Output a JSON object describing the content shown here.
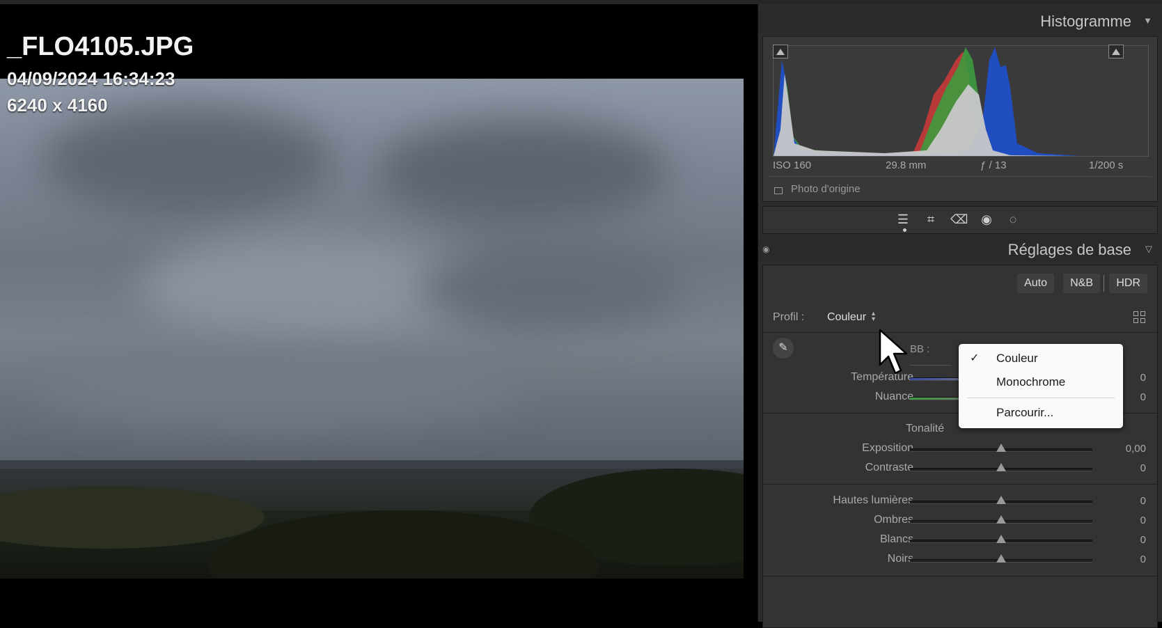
{
  "viewer": {
    "filename": "_FLO4105.JPG",
    "datetime": "04/09/2024 16:34:23",
    "dimensions": "6240 x 4160"
  },
  "histogram": {
    "title": "Histogramme",
    "exif": {
      "iso": "ISO 160",
      "focal": "29.8 mm",
      "aperture": "ƒ / 13",
      "shutter": "1/200 s"
    },
    "original_photo_label": "Photo d'origine"
  },
  "tools": [
    "edit-sliders-icon",
    "crop-icon",
    "eraser-icon",
    "red-eye-icon",
    "mask-icon"
  ],
  "basic": {
    "title": "Réglages de base",
    "buttons": {
      "auto": "Auto",
      "bw": "N&B",
      "hdr": "HDR"
    },
    "profile_label": "Profil :",
    "profile_value": "Couleur",
    "wb_label": "BB :",
    "sliders_wb": [
      {
        "label": "Température",
        "value": "0"
      },
      {
        "label": "Nuance",
        "value": "0"
      }
    ],
    "tone_title": "Tonalité",
    "sliders_tone": [
      {
        "label": "Exposition",
        "value": "0,00"
      },
      {
        "label": "Contraste",
        "value": "0"
      }
    ],
    "sliders_presence": [
      {
        "label": "Hautes lumières",
        "value": "0"
      },
      {
        "label": "Ombres",
        "value": "0"
      },
      {
        "label": "Blancs",
        "value": "0"
      },
      {
        "label": "Noirs",
        "value": "0"
      }
    ]
  },
  "profile_menu": {
    "items": [
      "Couleur",
      "Monochrome"
    ],
    "selected": "Couleur",
    "browse": "Parcourir..."
  },
  "colors": {
    "panel": "#2c2c2c",
    "red": "#c83a3a",
    "green": "#3e9a3e",
    "blue": "#1f4fc8",
    "luminance": "#c8c8c8"
  }
}
